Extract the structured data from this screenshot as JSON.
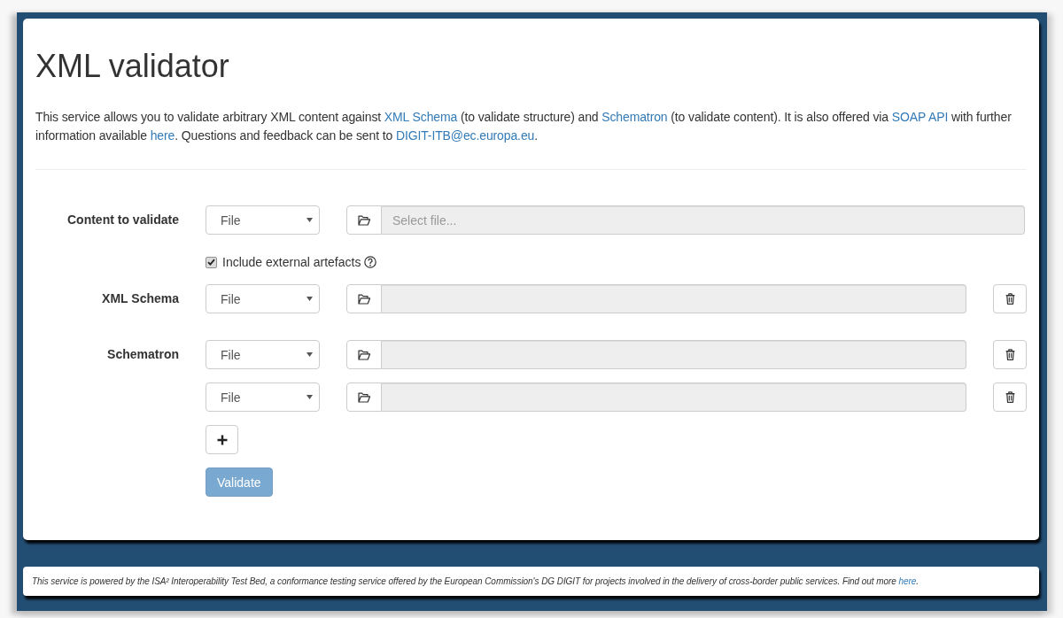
{
  "page": {
    "title": "XML validator",
    "description": [
      {
        "kind": "text",
        "text": "This service allows you to validate arbitrary XML content against "
      },
      {
        "kind": "link",
        "text": "XML Schema"
      },
      {
        "kind": "text",
        "text": " (to validate structure) and "
      },
      {
        "kind": "link",
        "text": "Schematron"
      },
      {
        "kind": "text",
        "text": " (to validate content). It is also offered via "
      },
      {
        "kind": "link",
        "text": "SOAP API"
      },
      {
        "kind": "text",
        "text": " with further information available "
      },
      {
        "kind": "link",
        "text": "here"
      },
      {
        "kind": "text",
        "text": ". Questions and feedback can be sent to "
      },
      {
        "kind": "link",
        "text": "DIGIT-ITB@ec.europa.eu"
      },
      {
        "kind": "text",
        "text": "."
      }
    ]
  },
  "form": {
    "content": {
      "label": "Content to validate",
      "source": "File",
      "placeholder": "Select file..."
    },
    "include_external": {
      "label": "Include external artefacts",
      "checked": true
    },
    "artefacts": [
      {
        "label": "XML Schema",
        "entries": [
          {
            "source": "File"
          }
        ]
      },
      {
        "label": "Schematron",
        "entries": [
          {
            "source": "File"
          },
          {
            "source": "File"
          }
        ]
      }
    ],
    "validate_button": {
      "label": "Validate",
      "disabled": true
    }
  },
  "footer": [
    {
      "kind": "text",
      "text": "This service is powered by the ISA² Interoperability Test Bed, a conformance testing service offered by the European Commission's DG DIGIT for projects involved in the delivery of cross-border public services. Find out more "
    },
    {
      "kind": "link",
      "text": "here"
    },
    {
      "kind": "text",
      "text": "."
    }
  ]
}
